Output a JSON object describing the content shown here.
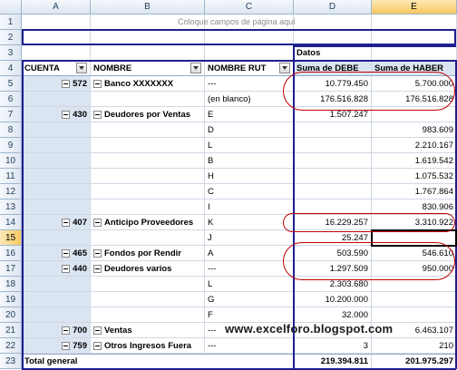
{
  "columns": [
    "A",
    "B",
    "C",
    "D",
    "E"
  ],
  "active_column": "E",
  "active_row": "15",
  "page_header_placeholder": "Coloque campos de página aquí",
  "data_label": "Datos",
  "headers": {
    "cuenta": "CUENTA",
    "nombre": "NOMBRE",
    "rut": "NOMBRE RUT",
    "debe": "Suma de DEBE",
    "haber": "Suma de HABER"
  },
  "rows": [
    {
      "num": "5",
      "cuenta": "572",
      "nombre": "Banco XXXXXXX",
      "rut": "---",
      "debe": "10.779.450",
      "haber": "5.700.000"
    },
    {
      "num": "6",
      "cuenta": "",
      "nombre": "",
      "rut": "(en blanco)",
      "debe": "176.516.828",
      "haber": "176.516.828"
    },
    {
      "num": "7",
      "cuenta": "430",
      "nombre": "Deudores por Ventas",
      "rut": "E",
      "debe": "1.507.247",
      "haber": ""
    },
    {
      "num": "8",
      "cuenta": "",
      "nombre": "",
      "rut": "D",
      "debe": "",
      "haber": "983.609"
    },
    {
      "num": "9",
      "cuenta": "",
      "nombre": "",
      "rut": "L",
      "debe": "",
      "haber": "2.210.167"
    },
    {
      "num": "10",
      "cuenta": "",
      "nombre": "",
      "rut": "B",
      "debe": "",
      "haber": "1.619.542"
    },
    {
      "num": "11",
      "cuenta": "",
      "nombre": "",
      "rut": "H",
      "debe": "",
      "haber": "1.075.532"
    },
    {
      "num": "12",
      "cuenta": "",
      "nombre": "",
      "rut": "C",
      "debe": "",
      "haber": "1.767.864"
    },
    {
      "num": "13",
      "cuenta": "",
      "nombre": "",
      "rut": "I",
      "debe": "",
      "haber": "830.906"
    },
    {
      "num": "14",
      "cuenta": "407",
      "nombre": "Anticipo Proveedores",
      "rut": "K",
      "debe": "16.229.257",
      "haber": "3.310.922"
    },
    {
      "num": "15",
      "cuenta": "",
      "nombre": "",
      "rut": "J",
      "debe": "25.247",
      "haber": ""
    },
    {
      "num": "16",
      "cuenta": "465",
      "nombre": "Fondos por Rendir",
      "rut": "A",
      "debe": "503.590",
      "haber": "546.610"
    },
    {
      "num": "17",
      "cuenta": "440",
      "nombre": "Deudores varios",
      "rut": "---",
      "debe": "1.297.509",
      "haber": "950.000"
    },
    {
      "num": "18",
      "cuenta": "",
      "nombre": "",
      "rut": "L",
      "debe": "2.303.680",
      "haber": ""
    },
    {
      "num": "19",
      "cuenta": "",
      "nombre": "",
      "rut": "G",
      "debe": "10.200.000",
      "haber": ""
    },
    {
      "num": "20",
      "cuenta": "",
      "nombre": "",
      "rut": "F",
      "debe": "32.000",
      "haber": ""
    },
    {
      "num": "21",
      "cuenta": "700",
      "nombre": "Ventas",
      "rut": "---",
      "debe": "",
      "haber": "6.463.107"
    },
    {
      "num": "22",
      "cuenta": "759",
      "nombre": "Otros Ingresos Fuera",
      "rut": "---",
      "debe": "3",
      "haber": "210"
    }
  ],
  "total": {
    "num": "23",
    "label": "Total general",
    "debe": "219.394.811",
    "haber": "201.975.297"
  },
  "row_numbers_top": [
    "1",
    "2",
    "3",
    "4"
  ],
  "watermark": "www.excelforo.blogspot.com",
  "colors": {
    "header_bg": "#dde6f1",
    "outline_blue": "#1f1f8f",
    "oval_red": "#c00000",
    "active_header": "#f7c75f"
  }
}
